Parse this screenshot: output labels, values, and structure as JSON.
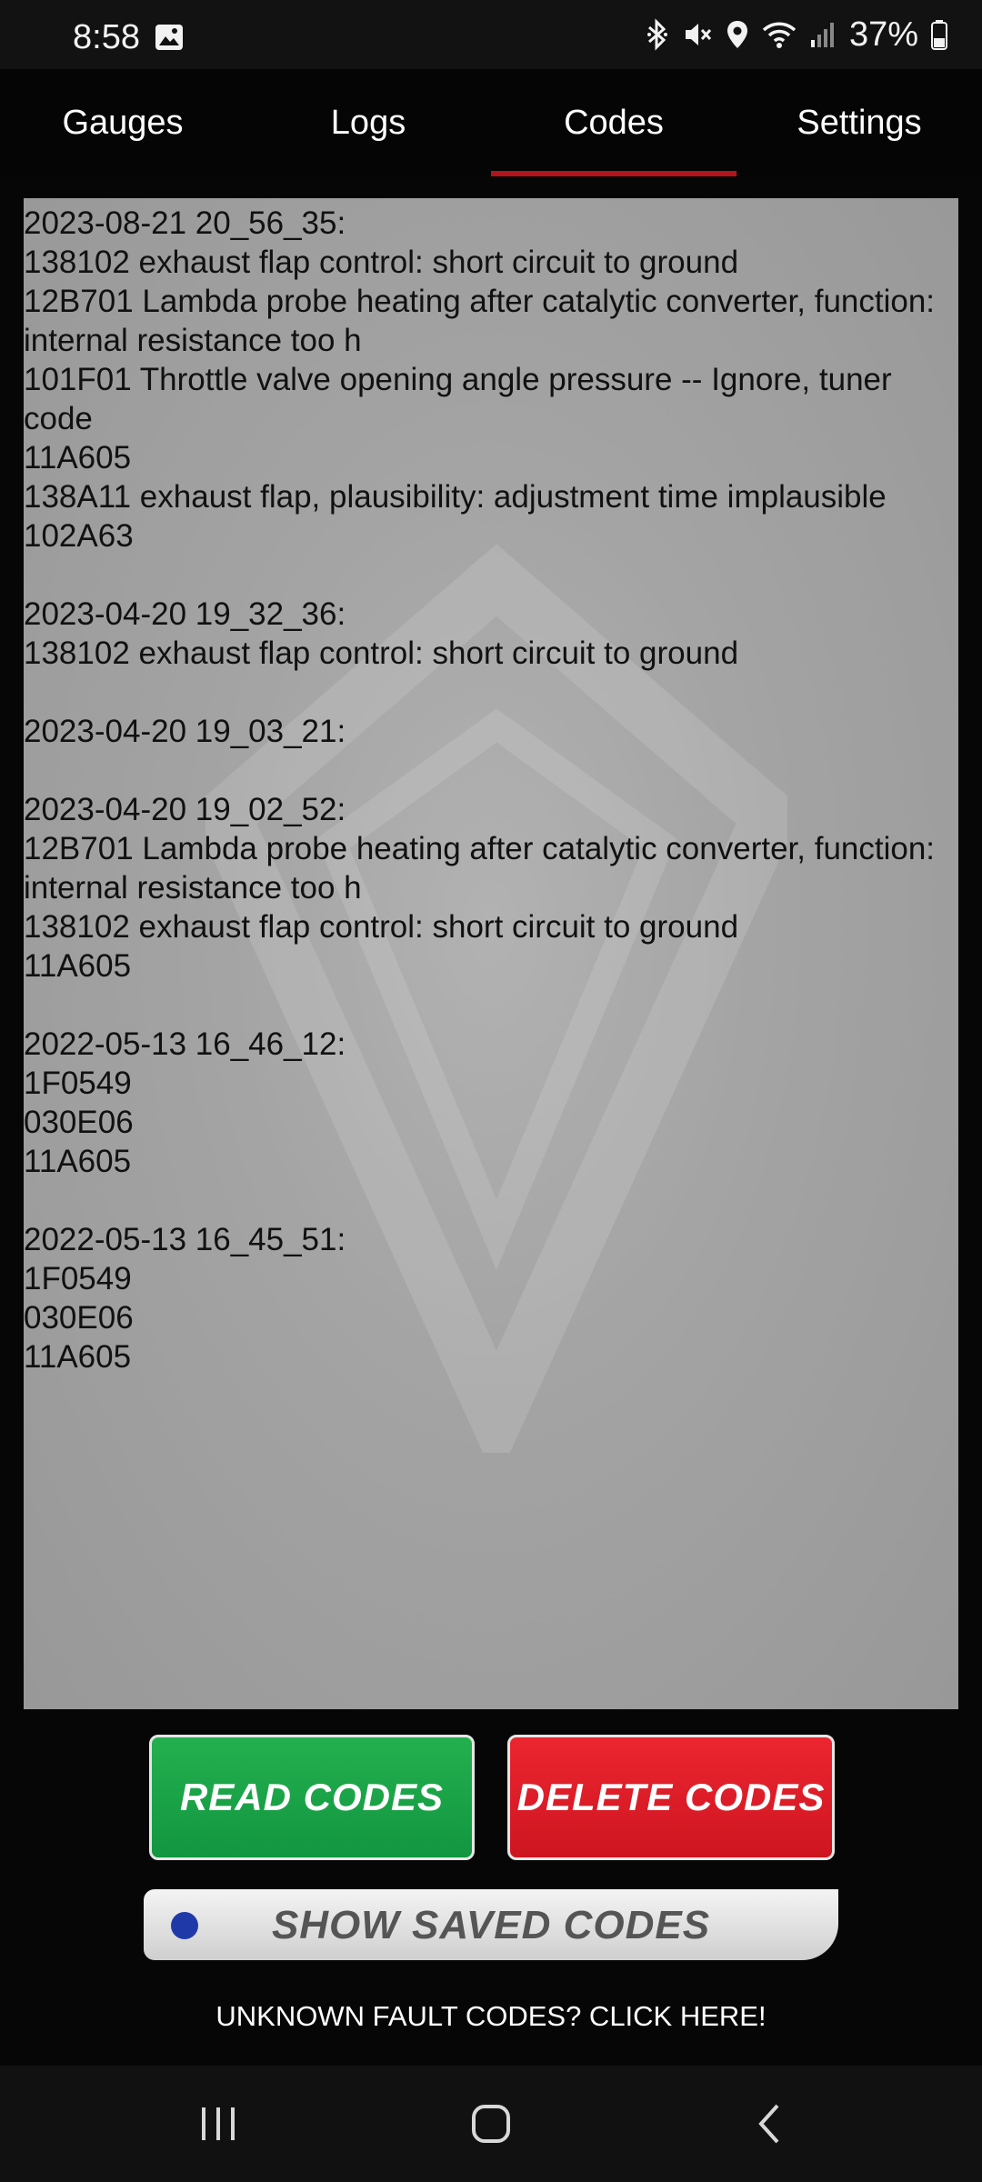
{
  "status_bar": {
    "time": "8:58",
    "battery": "37%",
    "icons": [
      "image-icon",
      "bluetooth-icon",
      "mute-icon",
      "location-icon",
      "wifi-icon",
      "signal-icon",
      "battery-icon"
    ]
  },
  "tabs": [
    {
      "label": "Gauges",
      "active": false
    },
    {
      "label": "Logs",
      "active": false
    },
    {
      "label": "Codes",
      "active": true
    },
    {
      "label": "Settings",
      "active": false
    }
  ],
  "codes": {
    "text": "2023-08-21 20_56_35:\n138102 exhaust flap control: short circuit to ground\n12B701 Lambda probe heating after catalytic converter, function: internal resistance too h\n101F01 Throttle valve opening angle pressure -- Ignore, tuner code\n11A605\n138A11 exhaust flap, plausibility: adjustment time implausible\n102A63\n\n2023-04-20 19_32_36:\n138102 exhaust flap control: short circuit to ground\n\n2023-04-20 19_03_21:\n\n2023-04-20 19_02_52:\n12B701 Lambda probe heating after catalytic converter, function: internal resistance too h\n138102 exhaust flap control: short circuit to ground\n11A605\n\n2022-05-13 16_46_12:\n1F0549\n030E06\n11A605\n\n2022-05-13 16_45_51:\n1F0549\n030E06\n11A605"
  },
  "buttons": {
    "read": "READ CODES",
    "delete": "DELETE CODES",
    "saved": "SHOW SAVED CODES",
    "unknown": "UNKNOWN FAULT CODES?  CLICK HERE!"
  },
  "colors": {
    "accent_tab": "#b3131b",
    "read_button": "#1ea84a",
    "delete_button": "#e01e28",
    "panel": "#a3a3a3"
  },
  "navbar": {
    "icons": [
      "recent-apps-icon",
      "home-icon",
      "back-icon"
    ]
  }
}
